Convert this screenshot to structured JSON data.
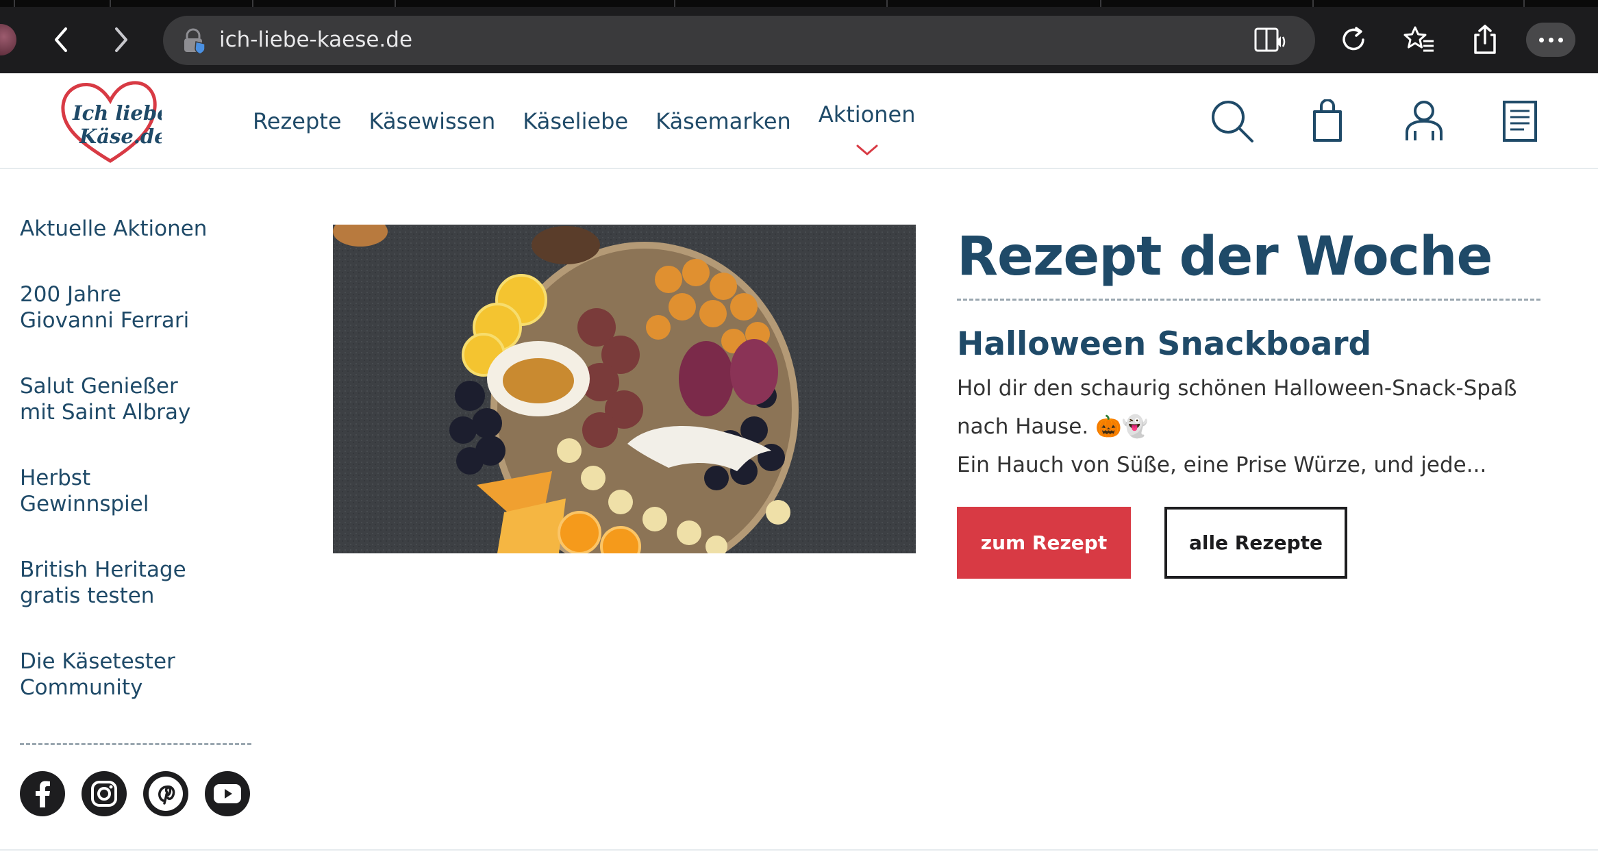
{
  "browser": {
    "url": "ich-liebe-kaese.de",
    "icons": [
      "back-icon",
      "forward-icon",
      "lock-icon",
      "reader-icon",
      "reload-icon",
      "favorites-icon",
      "share-icon",
      "more-icon"
    ]
  },
  "site": {
    "logo_text_line1": "Ich liebe",
    "logo_text_line2": "Käse.de",
    "nav": [
      {
        "label": "Rezepte"
      },
      {
        "label": "Käsewissen"
      },
      {
        "label": "Käseliebe"
      },
      {
        "label": "Käsemarken"
      },
      {
        "label": "Aktionen",
        "active": true
      }
    ],
    "header_icons": [
      "search-icon",
      "bag-icon",
      "user-icon",
      "list-icon"
    ]
  },
  "sidebar": {
    "items": [
      {
        "line1": "Aktuelle Aktionen",
        "line2": ""
      },
      {
        "line1": "200 Jahre",
        "line2": "Giovanni Ferrari"
      },
      {
        "line1": "Salut Genießer",
        "line2": "mit Saint Albray"
      },
      {
        "line1": "Herbst",
        "line2": "Gewinnspiel"
      },
      {
        "line1": "British Heritage",
        "line2": "gratis testen"
      },
      {
        "line1": "Die Käsetester",
        "line2": "Community"
      }
    ],
    "socials": [
      "facebook-icon",
      "instagram-icon",
      "pinterest-icon",
      "youtube-icon"
    ]
  },
  "feature": {
    "section_title": "Rezept der Woche",
    "recipe_title": "Halloween Snackboard",
    "desc_line1": "Hol dir den schaurig schönen Halloween-Snack-Spaß",
    "desc_line2": "nach Hause. 🎃👻",
    "desc_line3": "Ein Hauch von Süße, eine Prise Würze, und jede...",
    "primary_button": "zum Rezept",
    "secondary_button": "alle Rezepte"
  },
  "colors": {
    "brand_blue": "#1f4a68",
    "accent_red": "#d83a44",
    "chrome_bg": "#1c1c1e"
  }
}
